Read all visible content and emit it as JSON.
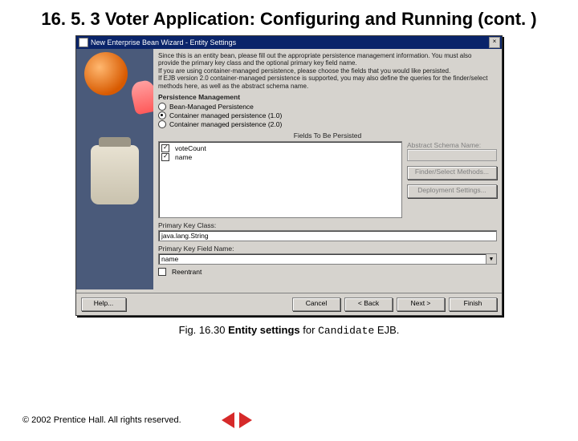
{
  "slide": {
    "title": "16. 5. 3   Voter Application: Configuring and Running (cont. )"
  },
  "window": {
    "title": "New Enterprise Bean Wizard - Entity Settings",
    "intro_line1": "Since this is an entity bean, please fill out the appropriate persistence management information. You must also",
    "intro_line2": "provide the primary key class and the optional primary key field name.",
    "intro_line3": "If you are using container-managed persistence, please choose the fields that you would like persisted.",
    "intro_line4": "If EJB version 2.0 container-managed persistence is supported, you may also define the queries for the finder/select",
    "intro_line5": "methods here, as well as the abstract schema name.",
    "persistence_label": "Persistence Management",
    "radio1": "Bean-Managed Persistence",
    "radio2": "Container managed persistence (1.0)",
    "radio3": "Container managed persistence (2.0)",
    "fields_title": "Fields To Be Persisted",
    "field1": "voteCount",
    "field2": "name",
    "abstract_label": "Abstract Schema Name:",
    "finder_btn": "Finder/Select Methods...",
    "deploy_btn": "Deployment Settings...",
    "pk_class_label": "Primary Key Class:",
    "pk_class_value": "java.lang.String",
    "pk_field_label": "Primary Key Field Name:",
    "pk_field_value": "name",
    "reentrant_label": "Reentrant"
  },
  "buttons": {
    "help": "Help...",
    "cancel": "Cancel",
    "back": "< Back",
    "next": "Next >",
    "finish": "Finish"
  },
  "caption": {
    "prefix": "Fig. 16.30",
    "mid": "Entity settings",
    "for": " for ",
    "code": "Candidate",
    "suffix": " EJB."
  },
  "footer": {
    "copyright": "© 2002 Prentice Hall. All rights reserved."
  }
}
